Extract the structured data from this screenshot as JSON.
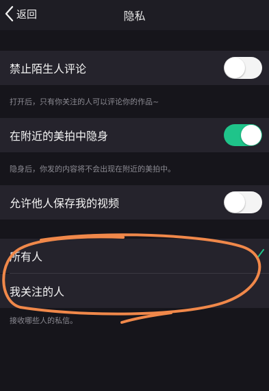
{
  "nav": {
    "back_label": "返回",
    "title": "隐私"
  },
  "settings": [
    {
      "label": "禁止陌生人评论",
      "toggle": "off",
      "note": "打开后，只有你关注的人可以评论你的作品~"
    },
    {
      "label": "在附近的美拍中隐身",
      "toggle": "on",
      "note": "隐身后，你发的内容将不会出现在附近的美拍中。"
    },
    {
      "label": "允许他人保存我的视频",
      "toggle": "off",
      "note": ""
    }
  ],
  "message_permission": {
    "options": [
      {
        "label": "所有人",
        "selected": true
      },
      {
        "label": "我关注的人",
        "selected": false
      }
    ],
    "note": "接收哪些人的私信。"
  },
  "colors": {
    "toggle_on": "#1fc48a",
    "check": "#1fc48a",
    "annotation": "#f0884a"
  }
}
